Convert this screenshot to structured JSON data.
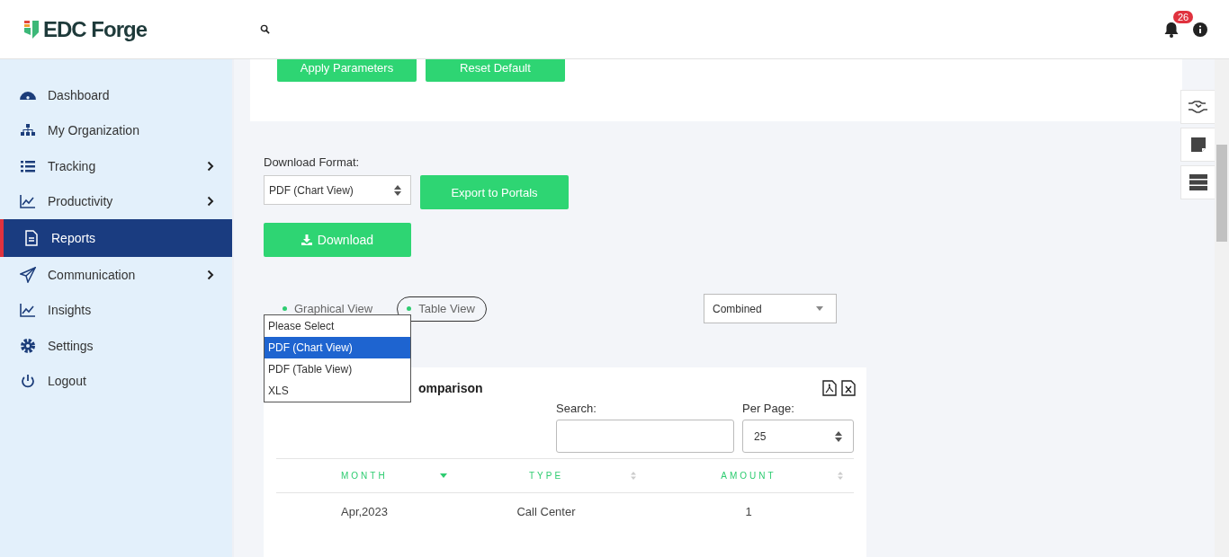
{
  "brand": {
    "name": "EDC Forge"
  },
  "header": {
    "notification_count": "26"
  },
  "sidebar": {
    "items": [
      {
        "label": "Dashboard",
        "has_submenu": false,
        "selected": false
      },
      {
        "label": "My Organization",
        "has_submenu": false,
        "selected": false
      },
      {
        "label": "Tracking",
        "has_submenu": true,
        "selected": false
      },
      {
        "label": "Productivity",
        "has_submenu": true,
        "selected": false
      },
      {
        "label": "Reports",
        "has_submenu": false,
        "selected": true
      },
      {
        "label": "Communication",
        "has_submenu": true,
        "selected": false
      },
      {
        "label": "Insights",
        "has_submenu": false,
        "selected": false
      },
      {
        "label": "Settings",
        "has_submenu": false,
        "selected": false
      },
      {
        "label": "Logout",
        "has_submenu": false,
        "selected": false
      }
    ]
  },
  "parameters": {
    "buttons": [
      "Apply Parameters",
      "Reset Default"
    ]
  },
  "download": {
    "label": "Download Format:",
    "value": "PDF (Chart View)",
    "export_button": "Export to Portals",
    "download_button": "Download",
    "options": [
      {
        "label": "Please Select",
        "selected": false
      },
      {
        "label": "PDF (Chart View)",
        "selected": true
      },
      {
        "label": "PDF (Table View)",
        "selected": false
      },
      {
        "label": "XLS",
        "selected": false
      }
    ]
  },
  "views": [
    {
      "label": "Graphical View",
      "selected": false
    },
    {
      "label": "Table View",
      "selected": true
    }
  ],
  "mode_select": {
    "value": "Combined"
  },
  "card": {
    "title": "omparison",
    "search_label": "Search:",
    "per_page_label": "Per Page:",
    "per_page": "25"
  },
  "table": {
    "columns": [
      {
        "label": "MONTH",
        "sorted": true
      },
      {
        "label": "TYPE",
        "sorted": false
      },
      {
        "label": "AMOUNT",
        "sorted": false
      }
    ],
    "rows": [
      [
        "Apr,2023",
        "Call Center",
        "1"
      ]
    ]
  }
}
